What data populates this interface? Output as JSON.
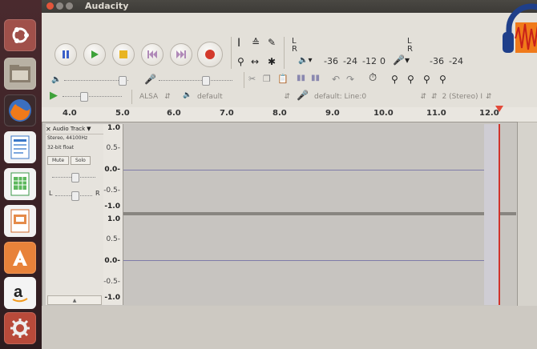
{
  "window": {
    "title": "Audacity"
  },
  "meters": {
    "playback": {
      "L": "L",
      "R": "R",
      "ticks": [
        "-36",
        "-24",
        "-12",
        "0"
      ]
    },
    "record": {
      "L": "L",
      "R": "R",
      "ticks": [
        "-36",
        "-24"
      ]
    }
  },
  "device": {
    "host": "ALSA",
    "output": "default",
    "input": "default: Line:0",
    "channels": "2 (Stereo) I"
  },
  "ruler": {
    "ticks": [
      "4.0",
      "5.0",
      "6.0",
      "7.0",
      "8.0",
      "9.0",
      "10.0",
      "11.0",
      "12.0"
    ]
  },
  "track": {
    "name": "Audio Track",
    "info1": "Stereo, 44100Hz",
    "info2": "32-bit float",
    "mute": "Mute",
    "solo": "Solo",
    "pan_left": "L",
    "pan_right": "R"
  },
  "vruler": {
    "top": [
      "1.0",
      "0.5-",
      "0.0-",
      "-0.5-",
      "-1.0"
    ],
    "bottom": [
      "1.0",
      "0.5-",
      "0.0-",
      "-0.5-",
      "-1.0"
    ]
  },
  "icons": {
    "launcher": [
      "ubuntu-dash-icon",
      "files-icon",
      "firefox-icon",
      "writer-icon",
      "calc-icon",
      "impress-icon",
      "software-center-icon",
      "amazon-icon",
      "settings-icon"
    ],
    "corner": "audacity-logo-icon"
  }
}
